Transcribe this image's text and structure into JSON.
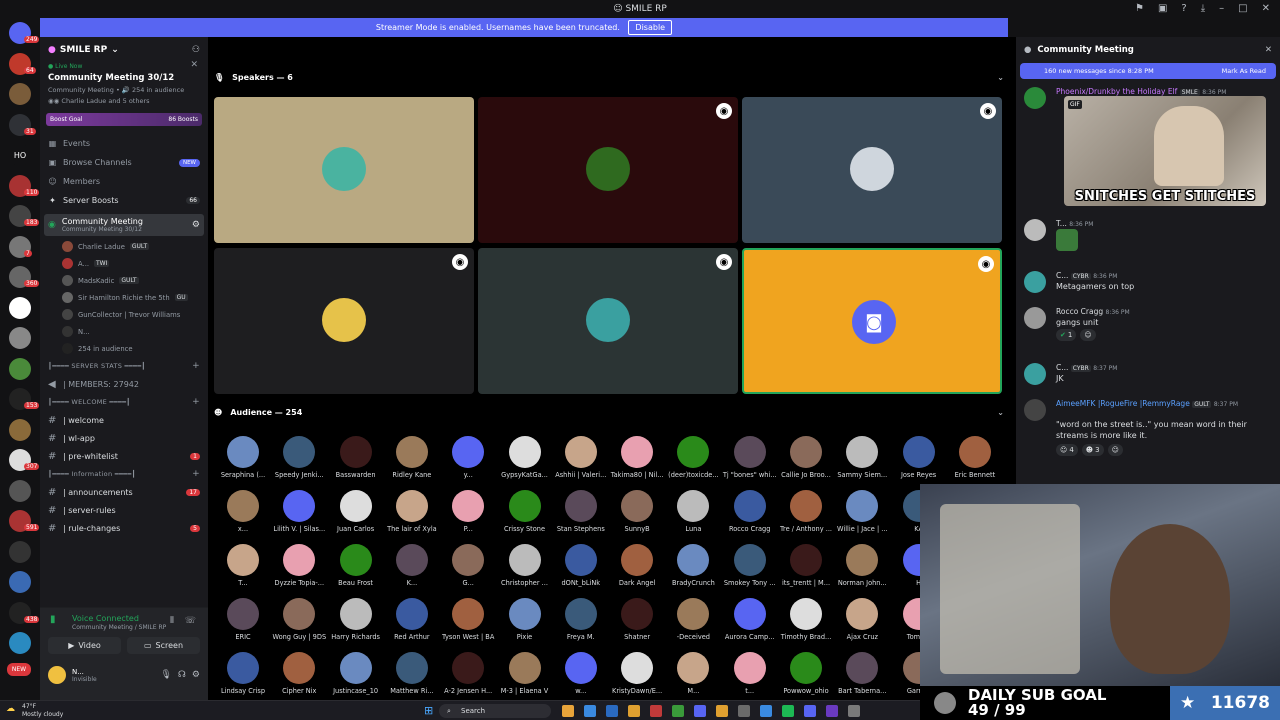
{
  "titlebar": {
    "title": "SMILE RP"
  },
  "banner": {
    "text": "Streamer Mode is enabled. Usernames have been truncated.",
    "button": "Disable"
  },
  "guilds": [
    {
      "label": "",
      "badge": "249",
      "color": "#5865f2"
    },
    {
      "label": "",
      "badge": "64",
      "color": "#c0392b"
    },
    {
      "label": "",
      "badge": "",
      "color": "#7a5c3a"
    },
    {
      "label": "",
      "badge": "31",
      "color": "#2f3136"
    },
    {
      "label": "HO",
      "badge": "",
      "color": "#121214"
    },
    {
      "label": "",
      "badge": "110",
      "color": "#a83232"
    },
    {
      "label": "",
      "badge": "183",
      "color": "#444"
    },
    {
      "label": "",
      "badge": "7",
      "color": "#777"
    },
    {
      "label": "",
      "badge": "360",
      "color": "#666"
    },
    {
      "label": "",
      "badge": "",
      "color": "#fff"
    },
    {
      "label": "",
      "badge": "",
      "color": "#888"
    },
    {
      "label": "",
      "badge": "",
      "color": "#4a8a3a"
    },
    {
      "label": "",
      "badge": "153",
      "color": "#222"
    },
    {
      "label": "",
      "badge": "",
      "color": "#8a6a3a"
    },
    {
      "label": "",
      "badge": "307",
      "color": "#ddd"
    },
    {
      "label": "",
      "badge": "",
      "color": "#555"
    },
    {
      "label": "",
      "badge": "591",
      "color": "#a33"
    },
    {
      "label": "",
      "badge": "",
      "color": "#333"
    },
    {
      "label": "",
      "badge": "",
      "color": "#3a6ab3"
    },
    {
      "label": "",
      "badge": "438",
      "color": "#222"
    },
    {
      "label": "",
      "badge": "",
      "color": "#2a8ac0"
    },
    {
      "label": "NEW",
      "badge": "",
      "color": "#da373c"
    }
  ],
  "server": {
    "name": "SMILE RP",
    "live_label": "Live Now",
    "live_title": "Community Meeting 30/12",
    "live_sub": "Community Meeting • 🔊 254 in audience",
    "live_users": "Charlie Ladue and 5 others",
    "boost_goal": "Boost Goal",
    "boost_count": "86 Boosts",
    "nav": [
      {
        "icon": "▦",
        "label": "Events",
        "right": "",
        "type": ""
      },
      {
        "icon": "▣",
        "label": "Browse Channels",
        "right": "NEW",
        "type": "new"
      },
      {
        "icon": "☺",
        "label": "Members",
        "right": "",
        "type": ""
      },
      {
        "icon": "✦",
        "label": "Server Boosts",
        "right": "66",
        "type": "count"
      }
    ],
    "active_channel": {
      "name": "Community Meeting",
      "sub": "Community Meeting 30/12"
    },
    "voice_users": [
      {
        "name": "Charlie Ladue",
        "tag": "GULT"
      },
      {
        "name": "A...",
        "tag": "TWI"
      },
      {
        "name": "MadsKadic",
        "tag": "GULT"
      },
      {
        "name": "Sir Hamilton Richie the 5th",
        "tag": "GU"
      },
      {
        "name": "GunCollector | Trevor Williams",
        "tag": ""
      },
      {
        "name": "N...",
        "tag": ""
      },
      {
        "name": "254 in audience",
        "tag": ""
      }
    ],
    "cat_stats": "┃━━━━ SERVER STATS ━━━━┃",
    "members": "| MEMBERS: 27942",
    "cat_welcome": "┃━━━━ WELCOME ━━━━┃",
    "welcome_channels": [
      {
        "name": "| welcome",
        "badge": ""
      },
      {
        "name": "| wl-app",
        "badge": ""
      },
      {
        "name": "| pre-whitelist",
        "badge": "1"
      }
    ],
    "cat_info": "┃━━━━ Information ━━━━┃",
    "info_channels": [
      {
        "name": "| announcements",
        "badge": "17"
      },
      {
        "name": "| server-rules",
        "badge": ""
      },
      {
        "name": "| rule-changes",
        "badge": "5"
      }
    ]
  },
  "voice": {
    "status": "Voice Connected",
    "sub": "Community Meeting / SMILE RP",
    "video": "Video",
    "screen": "Screen"
  },
  "user": {
    "name": "N...",
    "status": "Invisible"
  },
  "stage": {
    "speakers_label": "Speakers — 6",
    "audience_label": "Audience — 254",
    "tiles": [
      {
        "bg": "#b9a982",
        "ring": "#4ab3a0",
        "badge": false
      },
      {
        "bg": "#2a0a0c",
        "ring": "#2f6a1f",
        "badge": true
      },
      {
        "bg": "#3a4a58",
        "ring": "#cfd6dd",
        "badge": true
      },
      {
        "bg": "#1e1e20",
        "ring": "#e6c24a",
        "badge": true
      },
      {
        "bg": "#2b3434",
        "ring": "#3aa0a0",
        "badge": true
      },
      {
        "bg": "#f0a41f",
        "ring": "#5865f2",
        "badge": true
      }
    ],
    "audience": [
      [
        "Seraphina (...",
        "Speedy Jenki...",
        "Basswarden",
        "Ridley Kane",
        "y...",
        "GypsyKatGa...",
        "Ashhii | Valeri...",
        "Takima80 | Nil...",
        "(deer)toxicde...",
        "Tj \"bones\" whi...",
        "Callie Jo Broo...",
        "Sammy Siem...",
        "Jose Reyes",
        "Eric Bennett"
      ],
      [
        "x...",
        "Lilith V. | Silas...",
        "Juan Carlos",
        "The lair of Xyla",
        "P...",
        "Crissy Stone",
        "Stan Stephens",
        "SunnyB",
        "Luna",
        "Rocco Cragg",
        "Tre / Anthony ...",
        "Willie | Jace | ...",
        "KA"
      ],
      [
        "T...",
        "Dyzzie Topia-...",
        "Beau Frost",
        "K...",
        "G...",
        "Christopher ...",
        "dONt_bLiNk",
        "Dark Angel",
        "BradyCrunch",
        "Smokey Tony ...",
        "its_trentt | M...",
        "Norman John...",
        "H"
      ],
      [
        "ERIC",
        "Wong Guy | 9DS",
        "Harry Richards",
        "Red Arthur",
        "Tyson West | BA",
        "Pixie",
        "Freya M.",
        "Shatner",
        "-Deceived",
        "Aurora Camp...",
        "Timothy Brad...",
        "Ajax Cruz",
        "Tommy"
      ],
      [
        "Lindsay Crisp",
        "Cipher Nix",
        "Justincase_10",
        "Matthew Ri...",
        "A-2 Jensen H...",
        "M-3 | Elaena V",
        "w...",
        "KristyDawn/E...",
        "M...",
        "t...",
        "Powwow_ohio",
        "Bart Taberna...",
        "Garrett"
      ]
    ]
  },
  "chat": {
    "title": "Community Meeting",
    "new_messages": "160 new messages since 8:28 PM",
    "mark_read": "Mark As Read",
    "gif_label": "GIF",
    "gif_caption": "SNITCHES GET STITCHES",
    "messages": [
      {
        "author": "Phoenix/Drunkby the Holiday Elf",
        "tag": "SMLE",
        "time": "8:36 PM",
        "text": "",
        "color": "#c879ff"
      },
      {
        "author": "T...",
        "tag": "",
        "time": "8:36 PM",
        "text": "",
        "color": "#dbdee1"
      },
      {
        "author": "C...",
        "tag": "CYBR",
        "time": "8:36 PM",
        "text": "Metagamers on top",
        "color": "#dbdee1"
      },
      {
        "author": "Rocco Cragg",
        "tag": "",
        "time": "8:36 PM",
        "text": "gangs unit",
        "color": "#dbdee1"
      },
      {
        "author": "C...",
        "tag": "CYBR",
        "time": "8:37 PM",
        "text": "JK",
        "color": "#dbdee1"
      },
      {
        "author": "AimeeMFK |RogueFire |RemmyRage",
        "tag": "GULT",
        "time": "8:37 PM",
        "text": "\"word on the street is..\" you mean word in their streams is more like it.",
        "color": "#5aa0ff"
      }
    ],
    "reactions1": "1",
    "reactions2": [
      "4",
      "3"
    ]
  },
  "overlay": {
    "goal_title": "DAILY SUB GOAL",
    "goal_progress": "49 / 99",
    "count": "11678"
  },
  "taskbar": {
    "weather": "47°F",
    "weather_sub": "Mostly cloudy",
    "search": "Search"
  }
}
